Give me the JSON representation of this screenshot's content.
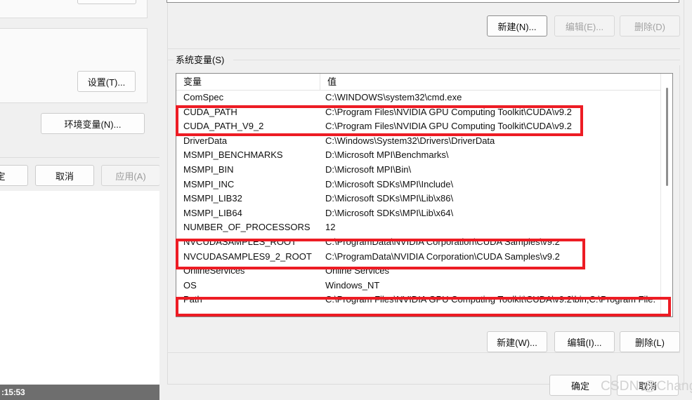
{
  "background_window": {
    "settings_button": "设置(T)...",
    "env_vars_button": "环境变量(N)...",
    "ok_button": "定",
    "cancel_button": "取消",
    "apply_button": "应用(A)"
  },
  "taskbar": {
    "time": ":15:53"
  },
  "env_dialog": {
    "user_section": {
      "new_button": "新建(N)...",
      "edit_button": "编辑(E)...",
      "delete_button": "删除(D)"
    },
    "system_section": {
      "group_label": "系统变量(S)",
      "columns": [
        "变量",
        "值"
      ],
      "rows": [
        {
          "name": "ComSpec",
          "value": "C:\\WINDOWS\\system32\\cmd.exe"
        },
        {
          "name": "CUDA_PATH",
          "value": "C:\\Program Files\\NVIDIA GPU Computing Toolkit\\CUDA\\v9.2"
        },
        {
          "name": "CUDA_PATH_V9_2",
          "value": "C:\\Program Files\\NVIDIA GPU Computing Toolkit\\CUDA\\v9.2"
        },
        {
          "name": "DriverData",
          "value": "C:\\Windows\\System32\\Drivers\\DriverData"
        },
        {
          "name": "MSMPI_BENCHMARKS",
          "value": "D:\\Microsoft MPI\\Benchmarks\\"
        },
        {
          "name": "MSMPI_BIN",
          "value": "D:\\Microsoft MPI\\Bin\\"
        },
        {
          "name": "MSMPI_INC",
          "value": "D:\\Microsoft SDKs\\MPI\\Include\\"
        },
        {
          "name": "MSMPI_LIB32",
          "value": "D:\\Microsoft SDKs\\MPI\\Lib\\x86\\"
        },
        {
          "name": "MSMPI_LIB64",
          "value": "D:\\Microsoft SDKs\\MPI\\Lib\\x64\\"
        },
        {
          "name": "NUMBER_OF_PROCESSORS",
          "value": "12"
        },
        {
          "name": "NVCUDASAMPLES_ROOT",
          "value": "C:\\ProgramData\\NVIDIA Corporation\\CUDA Samples\\v9.2"
        },
        {
          "name": "NVCUDASAMPLES9_2_ROOT",
          "value": "C:\\ProgramData\\NVIDIA Corporation\\CUDA Samples\\v9.2"
        },
        {
          "name": "OnlineServices",
          "value": "Online Services"
        },
        {
          "name": "OS",
          "value": "Windows_NT"
        },
        {
          "name": "Path",
          "value": "C:\\Program Files\\NVIDIA GPU Computing Toolkit\\CUDA\\v9.2\\bin;C:\\Program File..."
        }
      ],
      "new_button": "新建(W)...",
      "edit_button": "编辑(I)...",
      "delete_button": "删除(L)"
    },
    "footer": {
      "ok_button": "确定",
      "cancel_button": "取消"
    }
  },
  "annotations": {
    "highlight_color": "#ed1c24",
    "boxes": [
      "cuda-path-rows",
      "nvcudasamples-rows",
      "path-row"
    ]
  },
  "watermark": {
    "text": "CSDN @ChangYan.",
    "color": "#d2d2d2"
  }
}
